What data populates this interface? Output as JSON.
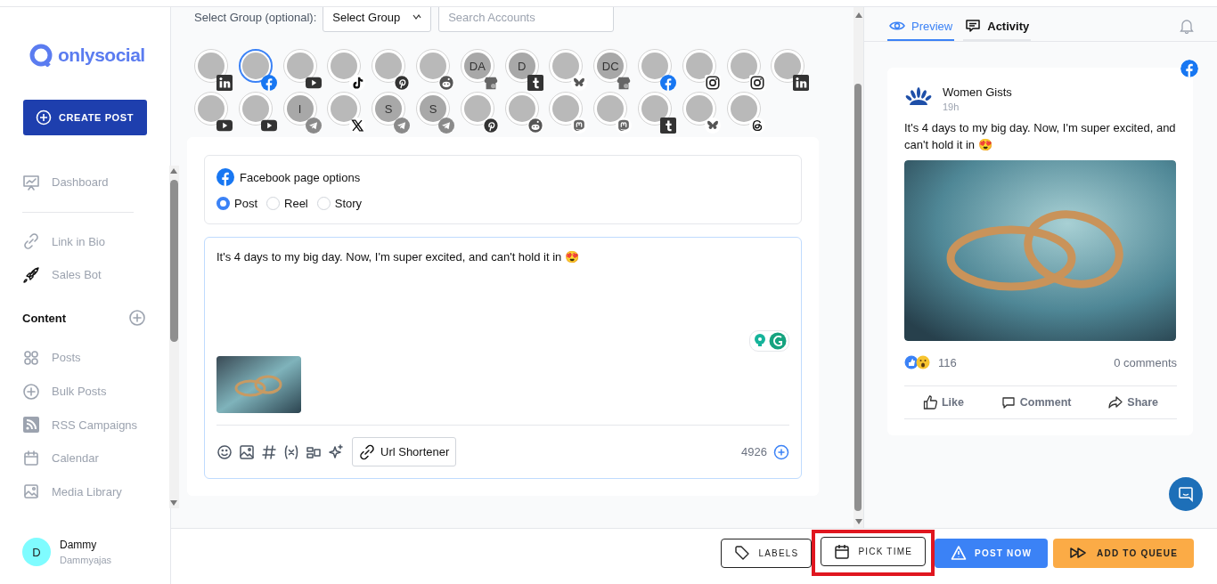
{
  "sidebar": {
    "logo_text": "onlysocial",
    "create_button": "CREATE POST",
    "nav_top": [
      {
        "label": "Dashboard"
      }
    ],
    "nav_tools": [
      {
        "label": "Link in Bio"
      },
      {
        "label": "Sales Bot"
      }
    ],
    "section_title": "Content",
    "content_items": [
      {
        "label": "Posts"
      },
      {
        "label": "Bulk Posts"
      },
      {
        "label": "RSS Campaigns"
      },
      {
        "label": "Calendar"
      },
      {
        "label": "Media Library"
      }
    ],
    "user": {
      "initial": "D",
      "name": "Dammy",
      "handle": "Dammyajas"
    }
  },
  "composer": {
    "group_label": "Select Group (optional):",
    "group_select": "Select Group",
    "search": {
      "placeholder": "Search Accounts"
    },
    "accounts": [
      {
        "kind": "linkedin",
        "selected": false
      },
      {
        "kind": "facebook",
        "selected": true
      },
      {
        "kind": "youtube",
        "selected": false
      },
      {
        "kind": "tiktok",
        "selected": false
      },
      {
        "kind": "pinterest",
        "selected": false
      },
      {
        "kind": "reddit",
        "selected": false
      },
      {
        "kind": "business",
        "initials": "DA",
        "selected": false
      },
      {
        "kind": "tumblr",
        "initials": "D",
        "selected": false
      },
      {
        "kind": "bluesky",
        "selected": false
      },
      {
        "kind": "business",
        "initials": "DC",
        "selected": false
      },
      {
        "kind": "facebook",
        "selected": false
      },
      {
        "kind": "instagram",
        "selected": false
      },
      {
        "kind": "instagram",
        "selected": false
      },
      {
        "kind": "linkedin",
        "selected": false
      },
      {
        "kind": "youtube",
        "selected": false
      },
      {
        "kind": "youtube",
        "selected": false
      },
      {
        "kind": "telegram",
        "initials": "I",
        "selected": false
      },
      {
        "kind": "x",
        "selected": false
      },
      {
        "kind": "telegram",
        "initials": "S",
        "selected": false
      },
      {
        "kind": "telegram",
        "initials": "S",
        "selected": false
      },
      {
        "kind": "pinterest",
        "selected": false
      },
      {
        "kind": "reddit",
        "selected": false
      },
      {
        "kind": "mastodon",
        "selected": false
      },
      {
        "kind": "mastodon",
        "selected": false
      },
      {
        "kind": "tumblr",
        "selected": false
      },
      {
        "kind": "bluesky",
        "selected": false
      },
      {
        "kind": "threads",
        "selected": false
      }
    ],
    "page_options": {
      "title": "Facebook page options",
      "types": [
        {
          "label": "Post",
          "selected": true
        },
        {
          "label": "Reel",
          "selected": false
        },
        {
          "label": "Story",
          "selected": false
        }
      ]
    },
    "editor": {
      "text": "It's 4 days to my big day. Now, I'm super excited, and can't hold it in 😍",
      "url_button": "Url Shortener",
      "count": "4926"
    }
  },
  "preview": {
    "tabs": [
      {
        "label": "Preview",
        "selected": true
      },
      {
        "label": "Activity",
        "selected": false
      }
    ],
    "post": {
      "page_name": "Women Gists",
      "time": "19h",
      "text": "It's 4 days to my big day. Now, I'm super excited, and can't hold it in 😍",
      "reactions": "116",
      "comments": "0 comments",
      "actions": [
        "Like",
        "Comment",
        "Share"
      ]
    }
  },
  "actions": [
    {
      "label": "LABELS",
      "kind": "outline",
      "highlighted": false
    },
    {
      "label": "PICK TIME",
      "kind": "outline",
      "highlighted": true
    },
    {
      "label": "POST NOW",
      "kind": "primary",
      "highlighted": false
    },
    {
      "label": "ADD TO QUEUE",
      "kind": "queue",
      "highlighted": false
    }
  ]
}
